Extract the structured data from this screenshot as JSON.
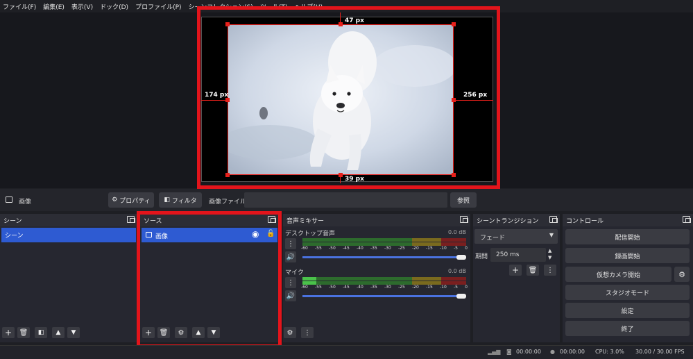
{
  "menu": [
    "ファイル(F)",
    "編集(E)",
    "表示(V)",
    "ドック(D)",
    "プロファイル(P)",
    "シーンコレクション(S)",
    "ツール(T)",
    "ヘルプ(H)"
  ],
  "preview": {
    "top_px": "47 px",
    "left_px": "174 px",
    "right_px": "256 px",
    "bottom_px": "39 px"
  },
  "context": {
    "source_name": "画像",
    "properties": "プロパティ",
    "filters": "フィルタ",
    "image_file_label": "画像ファイル",
    "image_file_value": "",
    "browse": "参照"
  },
  "scenes": {
    "title": "シーン",
    "items": [
      "シーン"
    ]
  },
  "sources": {
    "title": "ソース",
    "items": [
      "画像"
    ]
  },
  "mixer": {
    "title": "音声ミキサー",
    "channels": [
      {
        "name": "デスクトップ音声",
        "db": "0.0 dB",
        "level": 0.0
      },
      {
        "name": "マイク",
        "db": "0.0 dB",
        "level": 0.1
      }
    ],
    "ticks": [
      "-60",
      "-55",
      "-50",
      "-45",
      "-40",
      "-35",
      "-30",
      "-25",
      "-20",
      "-15",
      "-10",
      "-5",
      "0"
    ]
  },
  "transitions": {
    "title": "シーントランジション",
    "selected": "フェード",
    "duration_label": "期間",
    "duration": "250 ms"
  },
  "controls": {
    "title": "コントロール",
    "buttons": [
      "配信開始",
      "録画開始",
      "仮想カメラ開始",
      "スタジオモード",
      "設定",
      "終了"
    ]
  },
  "status": {
    "stream_time": "00:00:00",
    "rec_time": "00:00:00",
    "cpu": "CPU: 3.0%",
    "fps": "30.00 / 30.00 FPS"
  },
  "colors": {
    "accent": "#2e5bd2",
    "highlight": "#e3141b"
  }
}
